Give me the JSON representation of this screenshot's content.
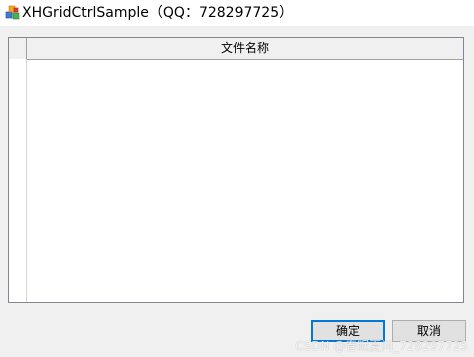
{
  "window": {
    "title": "XHGridCtrlSample（QQ：728297725）",
    "icon": "app-cubes-icon"
  },
  "grid": {
    "columns": [
      "文件名称"
    ],
    "rows": []
  },
  "buttons": {
    "ok_label": "确定",
    "cancel_label": "取消"
  },
  "watermark": "CSDN @春眠夏问_728297725",
  "colors": {
    "button_focus_border": "#0078d7",
    "grid_border": "#828790"
  }
}
